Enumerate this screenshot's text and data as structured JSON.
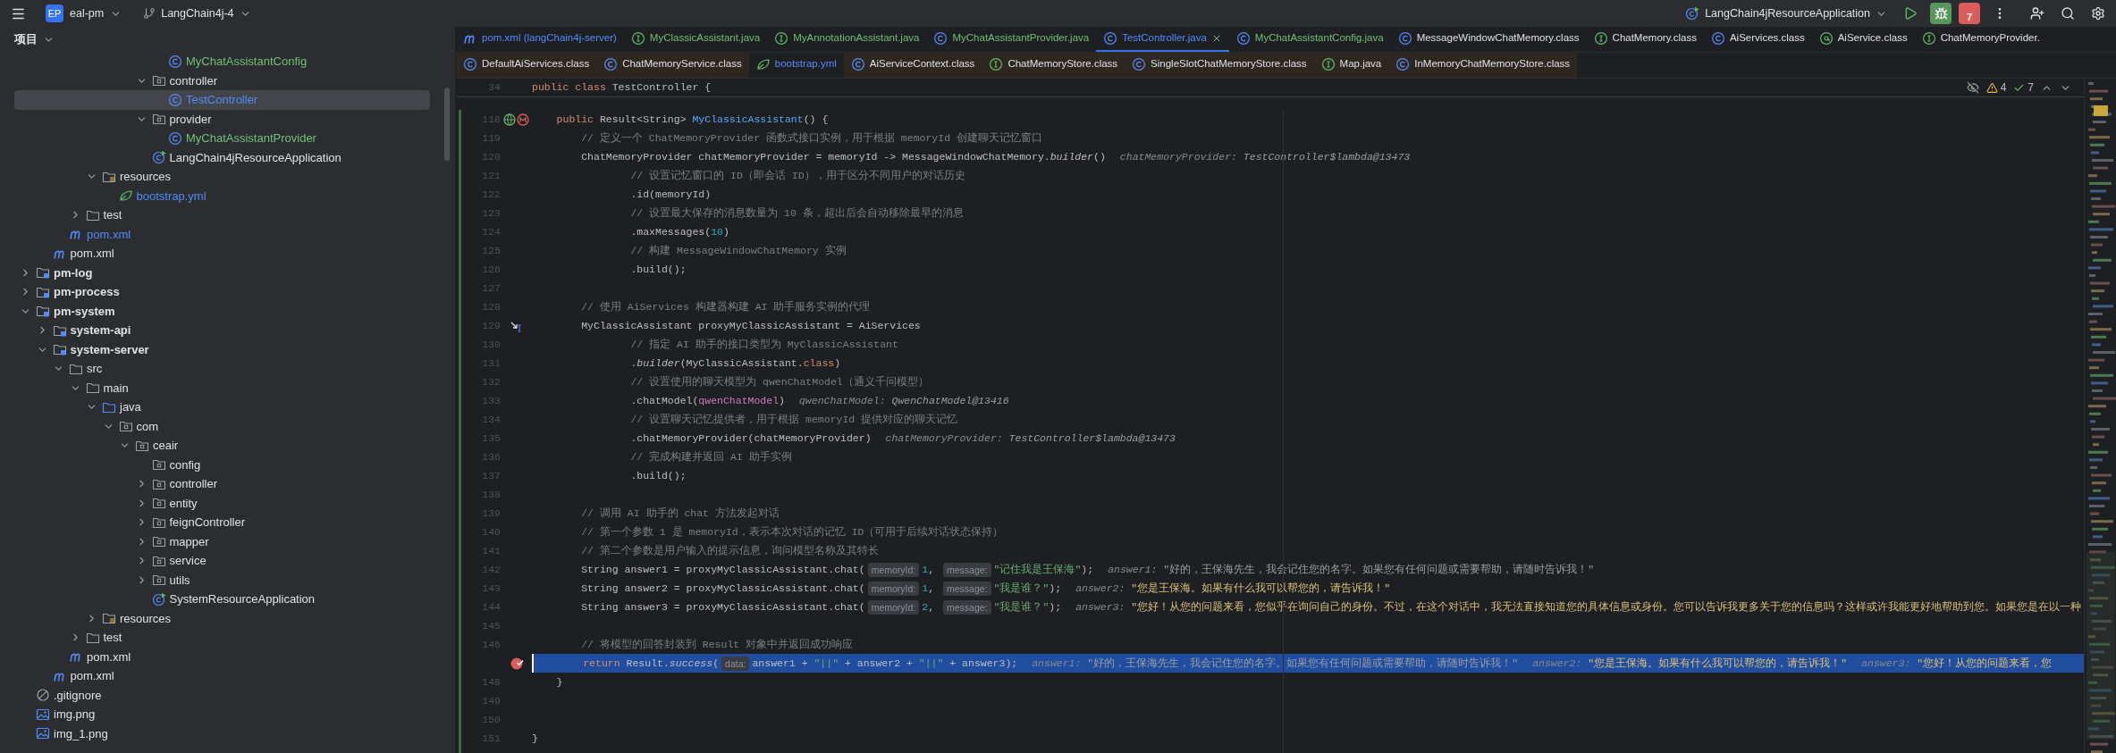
{
  "topbar": {
    "project_badge": "EP",
    "project": "eal-pm",
    "branch": "LangChain4j-4",
    "run_config": "LangChain4jResourceApplication",
    "stop_count": "7"
  },
  "sidebar": {
    "title": "项目",
    "tree": [
      {
        "children": [
          {
            "children": [
              {
                "children": [
                  {
                    "children": [
                      {
                        "children": [
                          {
                            "children": [
                              {
                                "children": [
                                  {
                                    "children": [
                                      {
                                        "name": "MyChatAssistantConfig",
                                        "kind": "class",
                                        "selected": false,
                                        "color": "#73bd79"
                                      }
                                    ]
                                  },
                                  {
                                    "name": "controller",
                                    "kind": "package",
                                    "expanded": true,
                                    "selected": false,
                                    "color": "#dfe1e5",
                                    "children": [
                                      {
                                        "name": "TestController",
                                        "kind": "class",
                                        "selected": true,
                                        "color": "#548af7"
                                      }
                                    ]
                                  },
                                  {
                                    "name": "provider",
                                    "kind": "package",
                                    "expanded": true,
                                    "selected": false,
                                    "color": "#dfe1e5",
                                    "children": [
                                      {
                                        "name": "MyChatAssistantProvider",
                                        "kind": "class",
                                        "selected": false,
                                        "color": "#73bd79"
                                      }
                                    ]
                                  },
                                  {
                                    "name": "LangChain4jResourceApplication",
                                    "kind": "app",
                                    "selected": false,
                                    "color": "#dfe1e5"
                                  }
                                ]
                              }
                            ]
                          }
                        ]
                      },
                      {
                        "name": "resources",
                        "kind": "resources",
                        "expanded": true,
                        "selected": false,
                        "color": "#dfe1e5",
                        "children": [
                          {
                            "name": "bootstrap.yml",
                            "kind": "yml",
                            "selected": false,
                            "color": "#548af7"
                          }
                        ]
                      }
                    ]
                  },
                  {
                    "name": "test",
                    "kind": "folder",
                    "expanded": false,
                    "selected": false,
                    "color": "#dfe1e5"
                  }
                ]
              },
              {
                "name": "pom.xml",
                "kind": "maven",
                "selected": false,
                "color": "#548af7"
              }
            ]
          },
          {
            "name": "pom.xml",
            "kind": "maven",
            "selected": false,
            "color": "#dfe1e5"
          }
        ]
      },
      {
        "name": "pm-log",
        "kind": "module",
        "expanded": false,
        "selected": false,
        "color": "#dfe1e5"
      },
      {
        "name": "pm-process",
        "kind": "module",
        "expanded": false,
        "selected": false,
        "color": "#dfe1e5"
      },
      {
        "name": "pm-system",
        "kind": "module",
        "expanded": true,
        "selected": false,
        "color": "#dfe1e5",
        "children": [
          {
            "name": "system-api",
            "kind": "module",
            "expanded": false,
            "selected": false,
            "color": "#dfe1e5"
          },
          {
            "name": "system-server",
            "kind": "module",
            "expanded": true,
            "selected": false,
            "color": "#dfe1e5",
            "children": [
              {
                "name": "src",
                "kind": "folder",
                "expanded": true,
                "selected": false,
                "color": "#dfe1e5",
                "children": [
                  {
                    "name": "main",
                    "kind": "folder",
                    "expanded": true,
                    "selected": false,
                    "color": "#dfe1e5",
                    "children": [
                      {
                        "name": "java",
                        "kind": "source",
                        "expanded": true,
                        "selected": false,
                        "color": "#dfe1e5",
                        "children": [
                          {
                            "name": "com",
                            "kind": "package",
                            "expanded": true,
                            "selected": false,
                            "color": "#dfe1e5",
                            "children": [
                              {
                                "name": "ceair",
                                "kind": "package",
                                "expanded": true,
                                "selected": false,
                                "color": "#dfe1e5",
                                "children": [
                                  {
                                    "name": "config",
                                    "kind": "package",
                                    "selected": false,
                                    "color": "#dfe1e5"
                                  },
                                  {
                                    "name": "controller",
                                    "kind": "package",
                                    "expanded": false,
                                    "selected": false,
                                    "color": "#dfe1e5"
                                  },
                                  {
                                    "name": "entity",
                                    "kind": "package",
                                    "expanded": false,
                                    "selected": false,
                                    "color": "#dfe1e5"
                                  },
                                  {
                                    "name": "feignController",
                                    "kind": "package",
                                    "expanded": false,
                                    "selected": false,
                                    "color": "#dfe1e5"
                                  },
                                  {
                                    "name": "mapper",
                                    "kind": "package",
                                    "expanded": false,
                                    "selected": false,
                                    "color": "#dfe1e5"
                                  },
                                  {
                                    "name": "service",
                                    "kind": "package",
                                    "expanded": false,
                                    "selected": false,
                                    "color": "#dfe1e5"
                                  },
                                  {
                                    "name": "utils",
                                    "kind": "package",
                                    "expanded": false,
                                    "selected": false,
                                    "color": "#dfe1e5"
                                  },
                                  {
                                    "name": "SystemResourceApplication",
                                    "kind": "app",
                                    "selected": false,
                                    "color": "#dfe1e5"
                                  }
                                ]
                              }
                            ]
                          }
                        ]
                      },
                      {
                        "name": "resources",
                        "kind": "resources",
                        "expanded": false,
                        "selected": false,
                        "color": "#dfe1e5"
                      }
                    ]
                  },
                  {
                    "name": "test",
                    "kind": "folder",
                    "expanded": false,
                    "selected": false,
                    "color": "#dfe1e5"
                  }
                ]
              },
              {
                "name": "pom.xml",
                "kind": "maven",
                "selected": false,
                "color": "#dfe1e5"
              }
            ]
          },
          {
            "name": "pom.xml",
            "kind": "maven",
            "selected": false,
            "color": "#dfe1e5"
          }
        ]
      },
      {
        "name": ".gitignore",
        "kind": "ignore",
        "selected": false,
        "color": "#dfe1e5"
      },
      {
        "name": "img.png",
        "kind": "image",
        "selected": false,
        "color": "#dfe1e5"
      },
      {
        "name": "img_1.png",
        "kind": "image",
        "selected": false,
        "color": "#dfe1e5"
      }
    ]
  },
  "tab_rows": [
    {
      "tabs": [
        {
          "label": "pom.xml (langChain4j-server)",
          "kind": "maven",
          "color": "#548af7",
          "selected": false,
          "library": false
        },
        {
          "label": "MyClassicAssistant.java",
          "kind": "interface",
          "color": "#73bd79",
          "selected": false,
          "library": false
        },
        {
          "label": "MyAnnotationAssistant.java",
          "kind": "interface",
          "color": "#73bd79",
          "selected": false,
          "library": false
        },
        {
          "label": "MyChatAssistantProvider.java",
          "kind": "class",
          "color": "#73bd79",
          "selected": false,
          "library": false
        },
        {
          "label": "TestController.java",
          "kind": "class",
          "color": "#548af7",
          "selected": true,
          "library": false
        },
        {
          "label": "MyChatAssistantConfig.java",
          "kind": "class",
          "color": "#73bd79",
          "selected": false,
          "library": false
        },
        {
          "label": "MessageWindowChatMemory.class",
          "kind": "class",
          "color": "#dfe1e5",
          "selected": false,
          "library": false
        },
        {
          "label": "ChatMemory.class",
          "kind": "interface",
          "color": "#dfe1e5",
          "selected": false,
          "library": false
        },
        {
          "label": "AiServices.class",
          "kind": "class",
          "color": "#dfe1e5",
          "selected": false,
          "library": false
        },
        {
          "label": "AiService.class",
          "kind": "annotation",
          "color": "#dfe1e5",
          "selected": false,
          "library": false
        },
        {
          "label": "ChatMemoryProvider.",
          "kind": "interface",
          "color": "#dfe1e5",
          "selected": false,
          "library": false
        }
      ]
    },
    {
      "tabs": [
        {
          "label": "DefaultAiServices.class",
          "kind": "class",
          "color": "#dfe1e5",
          "selected": false,
          "library": true
        },
        {
          "label": "ChatMemoryService.class",
          "kind": "class",
          "color": "#dfe1e5",
          "selected": false,
          "library": true
        },
        {
          "label": "bootstrap.yml",
          "kind": "yml",
          "color": "#548af7",
          "selected": false,
          "library": false
        },
        {
          "label": "AiServiceContext.class",
          "kind": "class",
          "color": "#dfe1e5",
          "selected": false,
          "library": true
        },
        {
          "label": "ChatMemoryStore.class",
          "kind": "interface",
          "color": "#dfe1e5",
          "selected": false,
          "library": true
        },
        {
          "label": "SingleSlotChatMemoryStore.class",
          "kind": "class",
          "color": "#dfe1e5",
          "selected": false,
          "library": true
        },
        {
          "label": "Map.java",
          "kind": "interface",
          "color": "#dfe1e5",
          "selected": false,
          "library": true
        },
        {
          "label": "InMemoryChatMemoryStore.class",
          "kind": "class",
          "color": "#dfe1e5",
          "selected": false,
          "library": true
        }
      ]
    }
  ],
  "editor": {
    "inspections": {
      "warnings": "4",
      "checks": "7"
    },
    "sticky_line": {
      "no": "34",
      "tokens": [
        {
          "kind": "keyword",
          "text": "public class "
        },
        {
          "kind": "plain",
          "text": "TestController {"
        }
      ]
    },
    "lines": [
      {
        "no": "118",
        "kind": "endpoint",
        "selected": false,
        "tokens": [
          {
            "kind": "keyword",
            "text": "    public "
          },
          {
            "kind": "plain",
            "text": "Result<String> "
          },
          {
            "kind": "method",
            "text": "MyClassicAssistant"
          },
          {
            "kind": "plain",
            "text": "() {"
          }
        ]
      },
      {
        "no": "119",
        "selected": false,
        "tokens": [
          {
            "kind": "comment",
            "text": "        // 定义一个 ChatMemoryProvider 函数式接口实例，用于根据 memoryId 创建聊天记忆窗口"
          }
        ]
      },
      {
        "no": "120",
        "selected": false,
        "tokens": [
          {
            "kind": "plain",
            "text": "        ChatMemoryProvider chatMemoryProvider = memoryId -> MessageWindowChatMemory."
          },
          {
            "kind": "italic",
            "text": "builder"
          },
          {
            "kind": "plain",
            "text": "()"
          },
          {
            "kind": "hint_name",
            "text": "chatMemoryProvider:"
          },
          {
            "kind": "hint_value",
            "text": "TestController$lambda@13473"
          }
        ]
      },
      {
        "no": "121",
        "selected": false,
        "tokens": [
          {
            "kind": "comment",
            "text": "                // 设置记忆窗口的 ID（即会话 ID），用于区分不同用户的对话历史"
          }
        ]
      },
      {
        "no": "122",
        "selected": false,
        "tokens": [
          {
            "kind": "plain",
            "text": "                .id(memoryId)"
          }
        ]
      },
      {
        "no": "123",
        "selected": false,
        "tokens": [
          {
            "kind": "comment",
            "text": "                // 设置最大保存的消息数量为 10 条，超出后会自动移除最早的消息"
          }
        ]
      },
      {
        "no": "124",
        "selected": false,
        "tokens": [
          {
            "kind": "plain",
            "text": "                .maxMessages("
          },
          {
            "kind": "number",
            "text": "10"
          },
          {
            "kind": "plain",
            "text": ")"
          }
        ]
      },
      {
        "no": "125",
        "selected": false,
        "tokens": [
          {
            "kind": "comment",
            "text": "                // 构建 MessageWindowChatMemory 实例"
          }
        ]
      },
      {
        "no": "126",
        "selected": false,
        "tokens": [
          {
            "kind": "plain",
            "text": "                .build();"
          }
        ]
      },
      {
        "no": "127",
        "selected": false
      },
      {
        "no": "128",
        "selected": false,
        "tokens": [
          {
            "kind": "comment",
            "text": "        // 使用 AiServices 构建器构建 AI 助手服务实例的代理"
          }
        ]
      },
      {
        "no": "129",
        "kind": "step",
        "selected": false,
        "tokens": [
          {
            "kind": "plain",
            "text": "        MyClassicAssistant proxyMyClassicAssistant = AiServices"
          }
        ]
      },
      {
        "no": "130",
        "selected": false,
        "tokens": [
          {
            "kind": "comment",
            "text": "                // 指定 AI 助手的接口类型为 MyClassicAssistant"
          }
        ]
      },
      {
        "no": "131",
        "selected": false,
        "tokens": [
          {
            "kind": "plain",
            "text": "                ."
          },
          {
            "kind": "italic",
            "text": "builder"
          },
          {
            "kind": "plain",
            "text": "(MyClassicAssistant."
          },
          {
            "kind": "keyword",
            "text": "class"
          },
          {
            "kind": "plain",
            "text": ")"
          }
        ]
      },
      {
        "no": "132",
        "selected": false,
        "tokens": [
          {
            "kind": "comment",
            "text": "                // 设置使用的聊天模型为 qwenChatModel（通义千问模型）"
          }
        ]
      },
      {
        "no": "133",
        "selected": false,
        "tokens": [
          {
            "kind": "plain",
            "text": "                .chatModel("
          },
          {
            "kind": "field",
            "text": "qwenChatModel"
          },
          {
            "kind": "plain",
            "text": ")"
          },
          {
            "kind": "hint_name",
            "text": "qwenChatModel:"
          },
          {
            "kind": "hint_value",
            "text": "QwenChatModel@13416"
          }
        ]
      },
      {
        "no": "134",
        "selected": false,
        "tokens": [
          {
            "kind": "comment",
            "text": "                // 设置聊天记忆提供者，用于根据 memoryId 提供对应的聊天记忆"
          }
        ]
      },
      {
        "no": "135",
        "selected": false,
        "tokens": [
          {
            "kind": "plain",
            "text": "                .chatMemoryProvider(chatMemoryProvider)"
          },
          {
            "kind": "hint_name",
            "text": "chatMemoryProvider:"
          },
          {
            "kind": "hint_value",
            "text": "TestController$lambda@13473"
          }
        ]
      },
      {
        "no": "136",
        "selected": false,
        "tokens": [
          {
            "kind": "comment",
            "text": "                // 完成构建并返回 AI 助手实例"
          }
        ]
      },
      {
        "no": "137",
        "selected": false,
        "tokens": [
          {
            "kind": "plain",
            "text": "                .build();"
          }
        ]
      },
      {
        "no": "138",
        "selected": false
      },
      {
        "no": "139",
        "selected": false,
        "tokens": [
          {
            "kind": "comment",
            "text": "        // 调用 AI 助手的 chat 方法发起对话"
          }
        ]
      },
      {
        "no": "140",
        "selected": false,
        "tokens": [
          {
            "kind": "comment",
            "text": "        // 第一个参数 1 是 memoryId，表示本次对话的记忆 ID（可用于后续对话状态保持）"
          }
        ]
      },
      {
        "no": "141",
        "selected": false,
        "tokens": [
          {
            "kind": "comment",
            "text": "        // 第二个参数是用户输入的提示信息，询问模型名称及其特长"
          }
        ]
      },
      {
        "no": "142",
        "selected": false,
        "tokens": [
          {
            "kind": "plain",
            "text": "        String answer1 = proxyMyClassicAssistant.chat("
          },
          {
            "kind": "param",
            "text": "memoryId:"
          },
          {
            "kind": "number",
            "text": "1"
          },
          {
            "kind": "plain",
            "text": ", "
          },
          {
            "kind": "param",
            "text": "message:"
          },
          {
            "kind": "string",
            "text": "\"记住我是王保海\""
          },
          {
            "kind": "plain",
            "text": ");"
          },
          {
            "kind": "hint_name",
            "text": "answer1:"
          },
          {
            "kind": "hint_value",
            "text": "\"好的，王保海先生，我会记住您的名字。如果您有任何问题或需要帮助，请随时告诉我！\""
          }
        ]
      },
      {
        "no": "143",
        "selected": false,
        "tokens": [
          {
            "kind": "plain",
            "text": "        String answer2 = proxyMyClassicAssistant.chat("
          },
          {
            "kind": "param",
            "text": "memoryId:"
          },
          {
            "kind": "number",
            "text": "1"
          },
          {
            "kind": "plain",
            "text": ", "
          },
          {
            "kind": "param",
            "text": "message:"
          },
          {
            "kind": "string",
            "text": "\"我是谁？\""
          },
          {
            "kind": "plain",
            "text": ");"
          },
          {
            "kind": "hint_name",
            "text": "answer2:"
          },
          {
            "kind": "hint_new",
            "text": "\"您是王保海。如果有什么我可以帮您的，请告诉我！\""
          }
        ]
      },
      {
        "no": "144",
        "selected": false,
        "tokens": [
          {
            "kind": "plain",
            "text": "        String answer3 = proxyMyClassicAssistant.chat("
          },
          {
            "kind": "param",
            "text": "memoryId:"
          },
          {
            "kind": "number",
            "text": "2"
          },
          {
            "kind": "plain",
            "text": ", "
          },
          {
            "kind": "param",
            "text": "message:"
          },
          {
            "kind": "string",
            "text": "\"我是谁？\""
          },
          {
            "kind": "plain",
            "text": ");"
          },
          {
            "kind": "hint_name",
            "text": "answer3:"
          },
          {
            "kind": "hint_new",
            "text": "\"您好！从您的问题来看，您似乎在询问自己的身份。不过，在这个对话中，我无法直接知道您的具体信息或身份。您可以告诉我更多关于您的信息吗？这样或许我能更好地帮助到您。如果您是在以一种"
          }
        ]
      },
      {
        "no": "145",
        "selected": false
      },
      {
        "no": "146",
        "selected": false,
        "tokens": [
          {
            "kind": "comment",
            "text": "        // 将模型的回答封装到 Result 对象中并返回成功响应"
          }
        ]
      },
      {
        "kind": "breakpoint",
        "selected": true,
        "tokens": [
          {
            "kind": "keyword",
            "text": "        return "
          },
          {
            "kind": "plain",
            "text": "Result."
          },
          {
            "kind": "italic",
            "text": "success"
          },
          {
            "kind": "plain",
            "text": "("
          },
          {
            "kind": "param",
            "text": "data:"
          },
          {
            "kind": "plain",
            "text": "answer1 + "
          },
          {
            "kind": "string",
            "text": "\"||\""
          },
          {
            "kind": "plain",
            "text": " + answer2 + "
          },
          {
            "kind": "string",
            "text": "\"||\""
          },
          {
            "kind": "plain",
            "text": " + answer3);"
          },
          {
            "kind": "hint_name",
            "text": "answer1:"
          },
          {
            "kind": "hint_value",
            "text": "\"好的，王保海先生，我会记住您的名字。如果您有任何问题或需要帮助，请随时告诉我！\""
          },
          {
            "kind": "hint_name",
            "text": "answer2:"
          },
          {
            "kind": "hint_new",
            "text": "\"您是王保海。如果有什么我可以帮您的，请告诉我！\""
          },
          {
            "kind": "hint_name",
            "text": "answer3:"
          },
          {
            "kind": "hint_new",
            "text": "\"您好！从您的问题来看，您"
          }
        ]
      },
      {
        "no": "148",
        "selected": false,
        "tokens": [
          {
            "kind": "plain",
            "text": "    }"
          }
        ]
      },
      {
        "no": "149",
        "selected": false
      },
      {
        "no": "150",
        "selected": false
      },
      {
        "no": "151",
        "selected": false,
        "tokens": [
          {
            "kind": "plain",
            "text": "}"
          }
        ]
      }
    ]
  }
}
